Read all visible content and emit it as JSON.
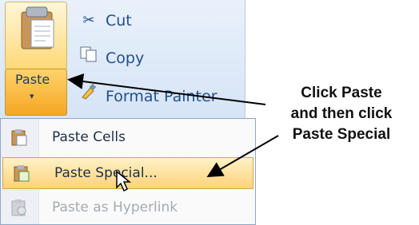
{
  "ribbon": {
    "paste_label": "Paste",
    "paste_arrow": "▾",
    "items": [
      {
        "label": "Cut",
        "icon": "scissors-icon"
      },
      {
        "label": "Copy",
        "icon": "copy-icon"
      },
      {
        "label": "Format Painter",
        "icon": "format-painter-icon"
      }
    ]
  },
  "menu": {
    "items": [
      {
        "label": "Paste Cells",
        "icon": "paste-cells-icon",
        "mnemonic": "P",
        "state": "normal"
      },
      {
        "label": "Paste Special...",
        "icon": "paste-special-icon",
        "mnemonic": "S",
        "state": "highlighted"
      },
      {
        "label": "Paste as Hyperlink",
        "icon": "paste-hyperlink-icon",
        "mnemonic": "H",
        "state": "disabled"
      }
    ]
  },
  "callout": {
    "lines": [
      "Click Paste",
      "and then click",
      "Paste Special"
    ]
  },
  "colors": {
    "ribbon_bg": "#d6e4f6",
    "highlight": "#ffd27a",
    "ribbon_text": "#1f4f8a"
  }
}
